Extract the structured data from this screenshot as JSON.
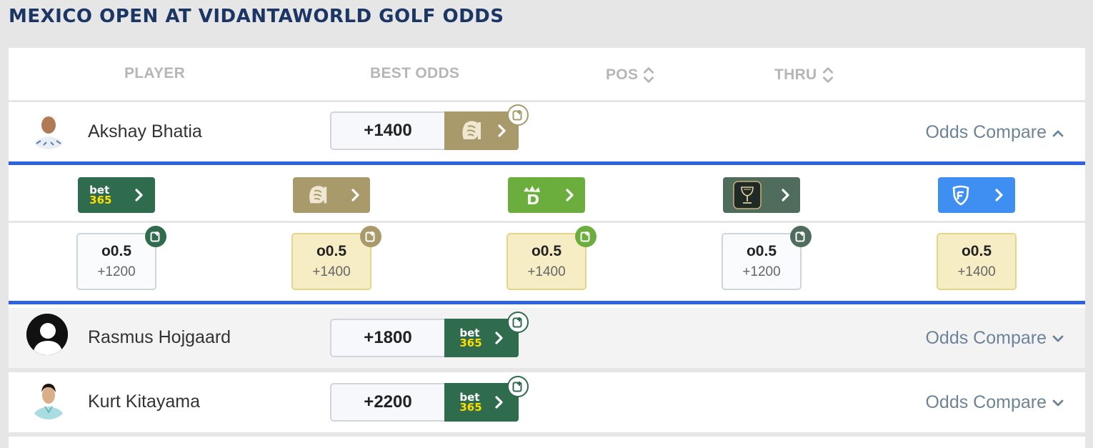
{
  "page": {
    "title": "MEXICO OPEN AT VIDANTAWORLD GOLF ODDS"
  },
  "header": {
    "player": "PLAYER",
    "best_odds": "BEST ODDS",
    "pos": "POS",
    "thru": "THRU"
  },
  "colors": {
    "bet365": "#2f6b4d",
    "mgm": "#a99a6b",
    "draftkings": "#6cae3e",
    "caesars": "#4f6c5c",
    "fanduel": "#3f8ef2",
    "accent_blue": "#2d63e2",
    "title": "#1b3564"
  },
  "players": [
    {
      "name": "Akshay Bhatia",
      "best_odds": "+1400",
      "best_book": "betmgm",
      "odds_compare": "Odds Compare",
      "expanded": true
    },
    {
      "name": "Rasmus Hojgaard",
      "best_odds": "+1800",
      "best_book": "bet365",
      "odds_compare": "Odds Compare",
      "expanded": false
    },
    {
      "name": "Kurt Kitayama",
      "best_odds": "+2200",
      "best_book": "bet365",
      "odds_compare": "Odds Compare",
      "expanded": false
    }
  ],
  "expanded": {
    "books": [
      {
        "name": "bet365",
        "icon": "bet365-logo",
        "line": "o0.5",
        "odds": "+1200",
        "highlight": false
      },
      {
        "name": "betmgm",
        "icon": "mgm-lion-logo",
        "line": "o0.5",
        "odds": "+1400",
        "highlight": true
      },
      {
        "name": "draftkings",
        "icon": "draftkings-crown-logo",
        "line": "o0.5",
        "odds": "+1400",
        "highlight": true
      },
      {
        "name": "caesars",
        "icon": "caesars-chalice-logo",
        "line": "o0.5",
        "odds": "+1200",
        "highlight": false
      },
      {
        "name": "fanduel",
        "icon": "fanduel-shield-logo",
        "line": "o0.5",
        "odds": "+1400",
        "highlight": true
      }
    ],
    "bet365_logo": {
      "top": "bet",
      "bottom": "365"
    }
  }
}
